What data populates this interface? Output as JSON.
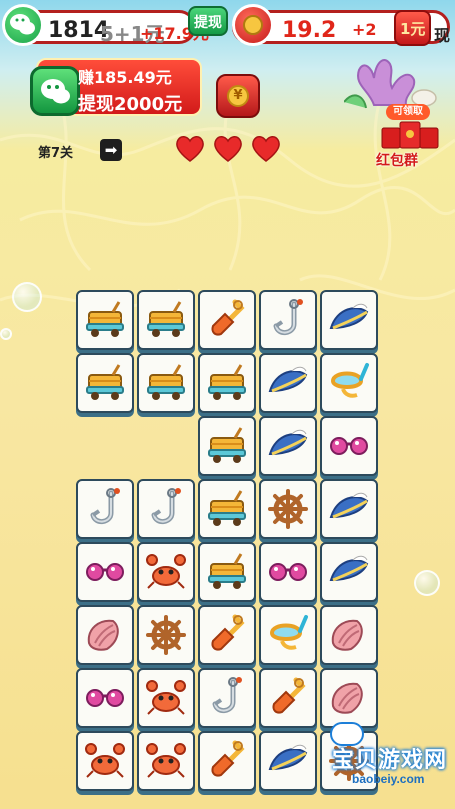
{
  "top_bar": {
    "left_amount": "1814",
    "left_overlay": "5+1元",
    "left_bonus": "+17.9元",
    "left_button": "提现",
    "right_amount": "19.2",
    "right_overlay": "+2",
    "right_button": "1元",
    "right_button_2": "现"
  },
  "withdraw_banner": {
    "earned": "赚185.49元",
    "withdraw": "提现2000元"
  },
  "yuan_button": {
    "symbol": "¥"
  },
  "level": {
    "label": "第7关",
    "arrow": "➡"
  },
  "lives": {
    "hearts": 3
  },
  "red_group": {
    "badge": "可领取",
    "label": "红包群"
  },
  "board": {
    "tiles": [
      {
        "col": 0,
        "row": 0,
        "item": "cart"
      },
      {
        "col": 1,
        "row": 0,
        "item": "cart"
      },
      {
        "col": 2,
        "row": 0,
        "item": "shovel"
      },
      {
        "col": 3,
        "row": 0,
        "item": "hook"
      },
      {
        "col": 4,
        "row": 0,
        "item": "hat"
      },
      {
        "col": 0,
        "row": 1,
        "item": "cart"
      },
      {
        "col": 1,
        "row": 1,
        "item": "cart"
      },
      {
        "col": 2,
        "row": 1,
        "item": "cart"
      },
      {
        "col": 3,
        "row": 1,
        "item": "hat"
      },
      {
        "col": 4,
        "row": 1,
        "item": "goggles"
      },
      {
        "col": 2,
        "row": 2,
        "item": "cart"
      },
      {
        "col": 3,
        "row": 2,
        "item": "hat"
      },
      {
        "col": 4,
        "row": 2,
        "item": "glasses"
      },
      {
        "col": 0,
        "row": 3,
        "item": "hook"
      },
      {
        "col": 1,
        "row": 3,
        "item": "hook"
      },
      {
        "col": 2,
        "row": 3,
        "item": "cart"
      },
      {
        "col": 3,
        "row": 3,
        "item": "wheel"
      },
      {
        "col": 4,
        "row": 3,
        "item": "hat"
      },
      {
        "col": 0,
        "row": 4,
        "item": "glasses"
      },
      {
        "col": 1,
        "row": 4,
        "item": "crab"
      },
      {
        "col": 2,
        "row": 4,
        "item": "cart"
      },
      {
        "col": 3,
        "row": 4,
        "item": "glasses"
      },
      {
        "col": 4,
        "row": 4,
        "item": "hat"
      },
      {
        "col": 0,
        "row": 5,
        "item": "shell"
      },
      {
        "col": 1,
        "row": 5,
        "item": "wheel"
      },
      {
        "col": 2,
        "row": 5,
        "item": "shovel"
      },
      {
        "col": 3,
        "row": 5,
        "item": "goggles"
      },
      {
        "col": 4,
        "row": 5,
        "item": "shell"
      },
      {
        "col": 0,
        "row": 6,
        "item": "glasses"
      },
      {
        "col": 1,
        "row": 6,
        "item": "crab"
      },
      {
        "col": 2,
        "row": 6,
        "item": "hook"
      },
      {
        "col": 3,
        "row": 6,
        "item": "shovel"
      },
      {
        "col": 4,
        "row": 6,
        "item": "shell"
      },
      {
        "col": 0,
        "row": 7,
        "item": "crab"
      },
      {
        "col": 1,
        "row": 7,
        "item": "crab"
      },
      {
        "col": 2,
        "row": 7,
        "item": "shovel"
      },
      {
        "col": 3,
        "row": 7,
        "item": "hat"
      },
      {
        "col": 4,
        "row": 7,
        "item": "wheel"
      }
    ]
  },
  "watermark": {
    "main": "宝贝游戏网",
    "sub": "baobeiy.com"
  },
  "colors": {
    "accent_red": "#d31a1a",
    "wechat_green": "#1aa34a",
    "tile_border": "#2d4a5c"
  }
}
